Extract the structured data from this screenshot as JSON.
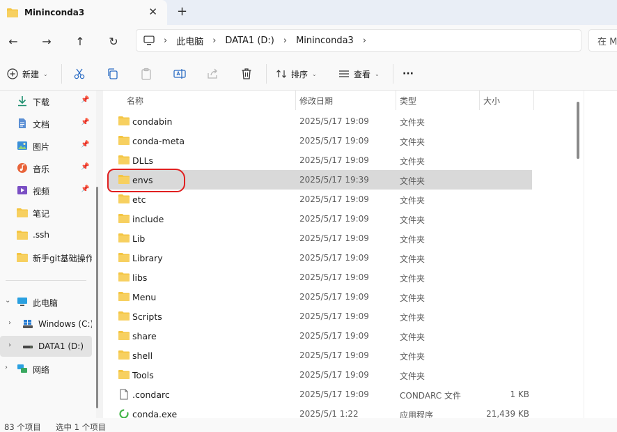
{
  "tab": {
    "title": "Mininconda3",
    "close": "✕",
    "new_tab": "+"
  },
  "nav": {
    "back": "←",
    "forward": "→",
    "up": "↑",
    "refresh": "↻",
    "breadcrumb": [
      "此电脑",
      "DATA1 (D:)",
      "Mininconda3"
    ],
    "search_placeholder": "在 M"
  },
  "toolbar": {
    "new_label": "新建",
    "sort_label": "排序",
    "view_label": "查看",
    "more": "···"
  },
  "sidebar": {
    "quick_access": [
      {
        "label": "下载",
        "icon": "download-icon"
      },
      {
        "label": "文档",
        "icon": "document-icon"
      },
      {
        "label": "图片",
        "icon": "pictures-icon"
      },
      {
        "label": "音乐",
        "icon": "music-icon"
      },
      {
        "label": "视频",
        "icon": "video-icon"
      },
      {
        "label": "笔记",
        "icon": "folder-icon"
      },
      {
        "label": ".ssh",
        "icon": "folder-icon"
      },
      {
        "label": "新手git基础操作",
        "icon": "folder-icon"
      }
    ],
    "this_pc": "此电脑",
    "drives": [
      "Windows (C:)",
      "DATA1 (D:)"
    ],
    "network": "网络"
  },
  "columns": {
    "name": "名称",
    "date": "修改日期",
    "type": "类型",
    "size": "大小"
  },
  "files": [
    {
      "name": "condabin",
      "date": "2025/5/17 19:09",
      "type": "文件夹",
      "size": "",
      "kind": "folder"
    },
    {
      "name": "conda-meta",
      "date": "2025/5/17 19:09",
      "type": "文件夹",
      "size": "",
      "kind": "folder"
    },
    {
      "name": "DLLs",
      "date": "2025/5/17 19:09",
      "type": "文件夹",
      "size": "",
      "kind": "folder"
    },
    {
      "name": "envs",
      "date": "2025/5/17 19:39",
      "type": "文件夹",
      "size": "",
      "kind": "folder"
    },
    {
      "name": "etc",
      "date": "2025/5/17 19:09",
      "type": "文件夹",
      "size": "",
      "kind": "folder"
    },
    {
      "name": "include",
      "date": "2025/5/17 19:09",
      "type": "文件夹",
      "size": "",
      "kind": "folder"
    },
    {
      "name": "Lib",
      "date": "2025/5/17 19:09",
      "type": "文件夹",
      "size": "",
      "kind": "folder"
    },
    {
      "name": "Library",
      "date": "2025/5/17 19:09",
      "type": "文件夹",
      "size": "",
      "kind": "folder"
    },
    {
      "name": "libs",
      "date": "2025/5/17 19:09",
      "type": "文件夹",
      "size": "",
      "kind": "folder"
    },
    {
      "name": "Menu",
      "date": "2025/5/17 19:09",
      "type": "文件夹",
      "size": "",
      "kind": "folder"
    },
    {
      "name": "Scripts",
      "date": "2025/5/17 19:09",
      "type": "文件夹",
      "size": "",
      "kind": "folder"
    },
    {
      "name": "share",
      "date": "2025/5/17 19:09",
      "type": "文件夹",
      "size": "",
      "kind": "folder"
    },
    {
      "name": "shell",
      "date": "2025/5/17 19:09",
      "type": "文件夹",
      "size": "",
      "kind": "folder"
    },
    {
      "name": "Tools",
      "date": "2025/5/17 19:09",
      "type": "文件夹",
      "size": "",
      "kind": "folder"
    },
    {
      "name": ".condarc",
      "date": "2025/5/17 19:09",
      "type": "CONDARC 文件",
      "size": "1 KB",
      "kind": "file"
    },
    {
      "name": "conda.exe",
      "date": "2025/5/1 1:22",
      "type": "应用程序",
      "size": "21,439 KB",
      "kind": "exe"
    }
  ],
  "status": {
    "count": "83 个项目",
    "selected": "选中 1 个项目"
  },
  "colors": {
    "folder": "#f4c542",
    "selection": "#d9d9d9",
    "annotation": "#e02020"
  }
}
